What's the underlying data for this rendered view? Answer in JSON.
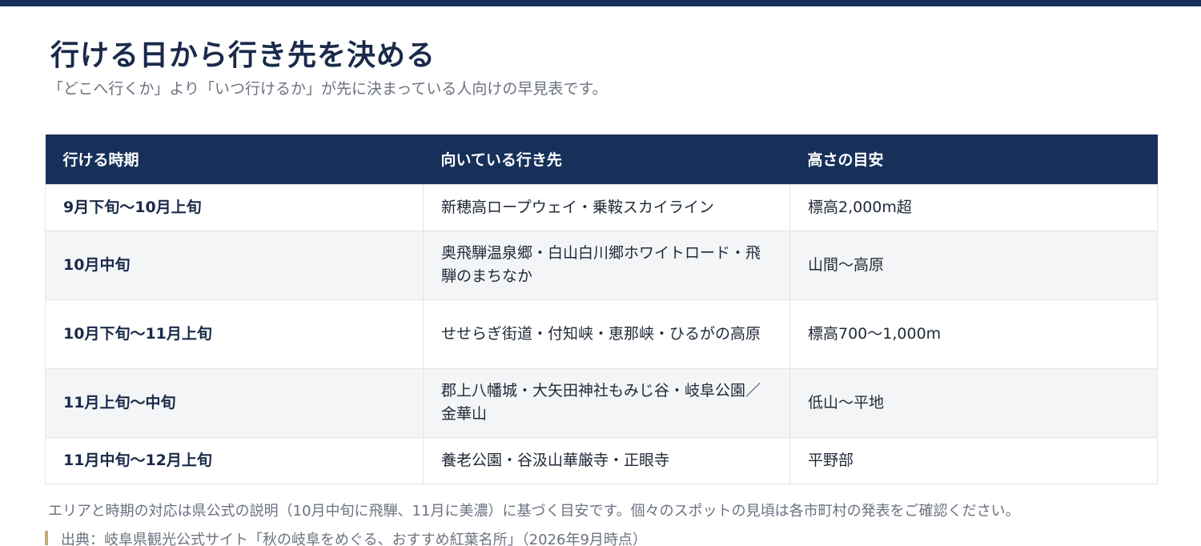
{
  "header": {
    "title": "行ける日から行き先を決める",
    "subtitle": "「どこへ行くか」より「いつ行けるか」が先に決まっている人向けの早見表です。"
  },
  "table": {
    "columns": [
      "行ける時期",
      "向いている行き先",
      "高さの目安"
    ],
    "rows": [
      {
        "period": "9月下旬〜10月上旬",
        "destination": "新穂高ロープウェイ・乗鞍スカイライン",
        "altitude": "標高2,000m超"
      },
      {
        "period": "10月中旬",
        "destination": "奥飛騨温泉郷・白山白川郷ホワイトロード・飛騨のまちなか",
        "altitude": "山間〜高原"
      },
      {
        "period": "10月下旬〜11月上旬",
        "destination": "せせらぎ街道・付知峡・恵那峡・ひるがの高原",
        "altitude": "標高700〜1,000m"
      },
      {
        "period": "11月上旬〜中旬",
        "destination": "郡上八幡城・大矢田神社もみじ谷・岐阜公園／金華山",
        "altitude": "低山〜平地"
      },
      {
        "period": "11月中旬〜12月上旬",
        "destination": "養老公園・谷汲山華厳寺・正眼寺",
        "altitude": "平野部"
      }
    ]
  },
  "footer": {
    "note": "エリアと時期の対応は県公式の説明（10月中旬に飛騨、11月に美濃）に基づく目安です。個々のスポットの見頃は各市町村の発表をご確認ください。",
    "source": "出典：岐阜県観光公式サイト「秋の岐阜をめぐる、おすすめ紅葉名所」（2026年9月時点）"
  },
  "colors": {
    "header_bg": "#16305a",
    "title": "#1b2a4a",
    "muted_text": "#6b7280",
    "alt_row": "#f4f5f7",
    "source_accent": "#c8a96a"
  }
}
